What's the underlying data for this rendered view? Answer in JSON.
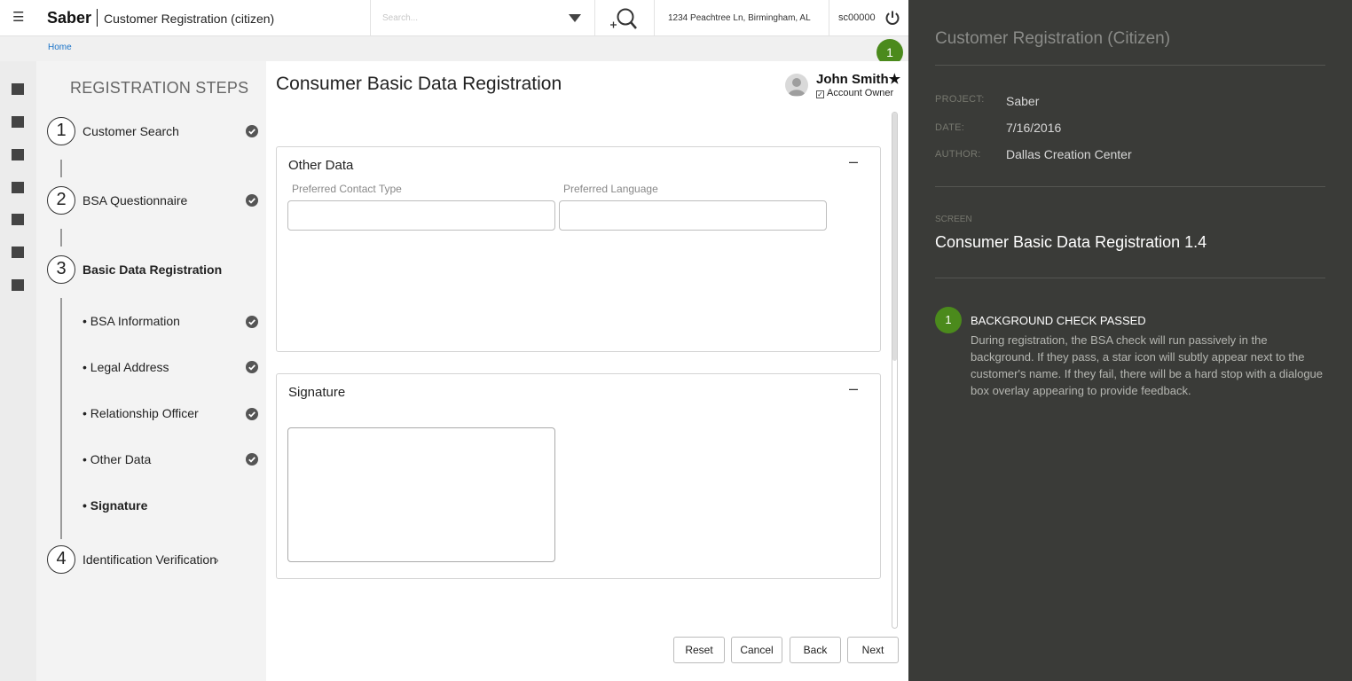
{
  "topbar": {
    "brand": "Saber",
    "app_title": "Customer Registration (citizen)",
    "search_placeholder": "Search...",
    "address": "1234 Peachtree Ln, Birmingham, AL",
    "user_id": "sc00000"
  },
  "breadcrumb": {
    "home": "Home"
  },
  "notification": {
    "count": "1"
  },
  "steps": {
    "title": "REGISTRATION STEPS",
    "items": [
      {
        "number": "1",
        "label": "Customer Search",
        "done": true
      },
      {
        "number": "2",
        "label": "BSA Questionnaire",
        "done": true
      },
      {
        "number": "3",
        "label": "Basic Data Registration",
        "done": false
      },
      {
        "number": "4",
        "label": "Identification Verification",
        "done": false
      }
    ],
    "sub_items": [
      {
        "label": "• BSA Information",
        "done": true
      },
      {
        "label": "• Legal Address",
        "done": true
      },
      {
        "label": "• Relationship Officer",
        "done": true
      },
      {
        "label": "• Other Data",
        "done": true
      },
      {
        "label": "• Signature",
        "done": false
      }
    ]
  },
  "main": {
    "page_title": "Consumer Basic Data Registration",
    "customer_name": "John Smith★",
    "account_owner": "Account Owner",
    "sections": {
      "other_data": {
        "title": "Other Data",
        "collapse": "–",
        "fields": [
          {
            "label": "Preferred Contact Type",
            "value": ""
          },
          {
            "label": "Preferred Language",
            "value": ""
          }
        ]
      },
      "signature": {
        "title": "Signature",
        "collapse": "–"
      }
    },
    "buttons": {
      "reset": "Reset",
      "cancel": "Cancel",
      "back": "Back",
      "next": "Next"
    }
  },
  "annotation": {
    "title": "Customer Registration (Citizen)",
    "meta": [
      {
        "key": "PROJECT:",
        "value": "Saber"
      },
      {
        "key": "DATE:",
        "value": "7/16/2016"
      },
      {
        "key": "AUTHOR:",
        "value": "Dallas Creation Center"
      }
    ],
    "screen_key": "SCREEN",
    "screen_value": "Consumer Basic Data Registration 1.4",
    "note": {
      "number": "1",
      "title": "BACKGROUND CHECK PASSED",
      "body": "During registration, the BSA check will run passively in the background.  If they pass, a star icon will subtly appear next to the customer's name.  If they fail, there will be a hard stop with a dialogue box overlay appearing to provide feedback."
    }
  },
  "colors": {
    "accent_green": "#4b8a1c",
    "annotation_bg": "#3a3b38",
    "link_blue": "#1a73c8"
  },
  "icons": [
    "menu-icon",
    "chevron-down-icon",
    "add-search-icon",
    "power-icon",
    "check-circle-icon",
    "chevron-right-icon",
    "user-avatar-icon"
  ]
}
